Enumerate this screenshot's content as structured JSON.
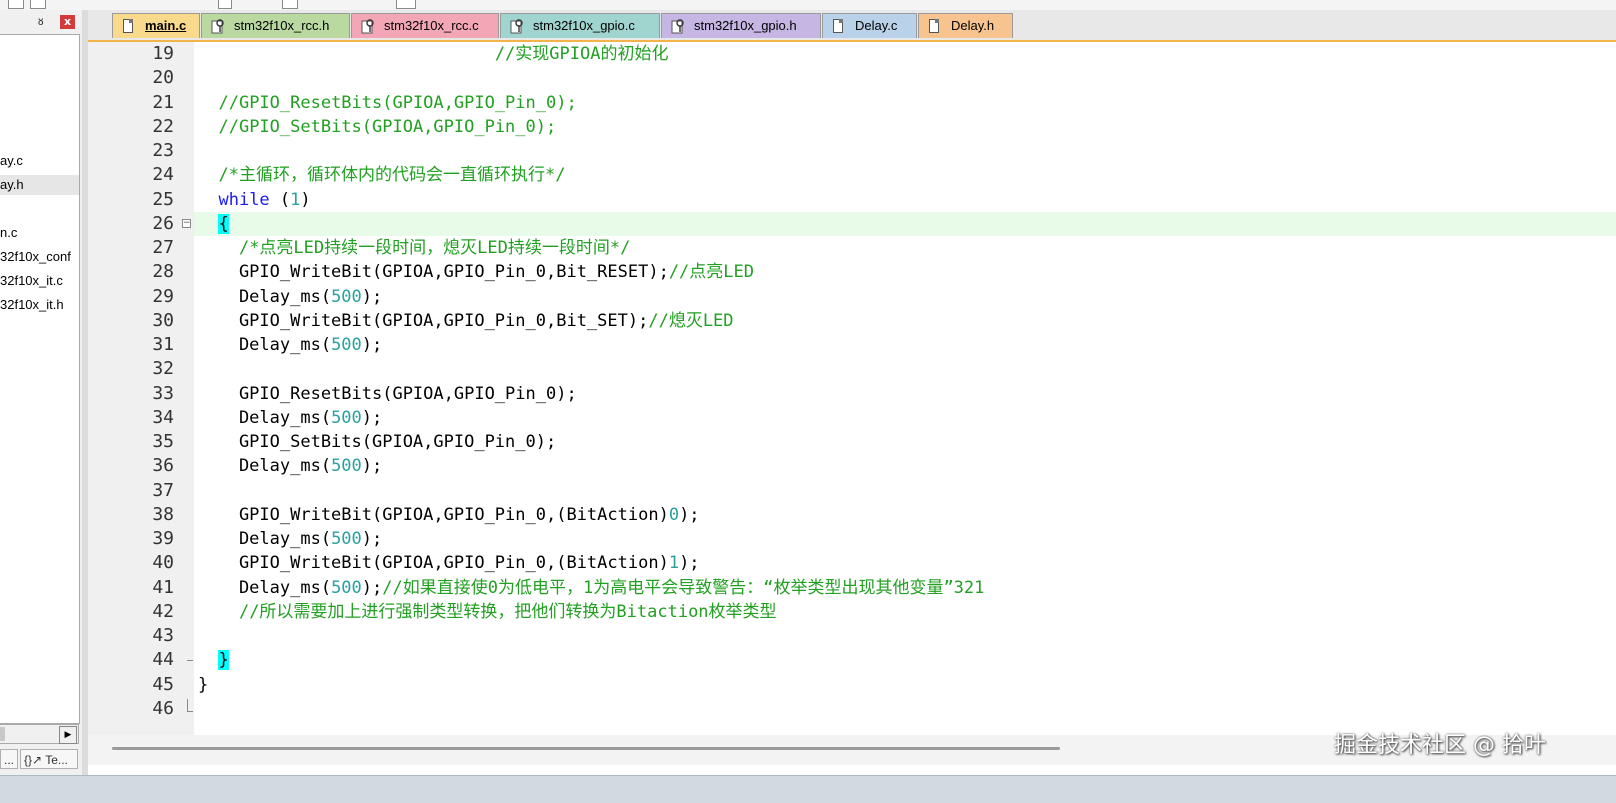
{
  "project_panel": {
    "pin_glyph": "ᵖ",
    "close_glyph": "x",
    "tree_items": [
      {
        "label": "ay.c",
        "selected": false
      },
      {
        "label": "ay.h",
        "selected": true
      },
      {
        "label": "n.c",
        "selected": false
      },
      {
        "label": "32f10x_conf",
        "selected": false
      },
      {
        "label": "32f10x_it.c",
        "selected": false
      },
      {
        "label": "32f10x_it.h",
        "selected": false
      }
    ],
    "bottom_tabs": [
      {
        "label": "..."
      },
      {
        "label": "{}↗ Te..."
      }
    ],
    "scroll_arrow": "▶"
  },
  "tabs": [
    {
      "label": "main.c",
      "active": true,
      "icon": "document-icon",
      "color": "#f9d98b"
    },
    {
      "label": "stm32f10x_rcc.h",
      "active": false,
      "icon": "key-icon",
      "color": "#b9d9a1"
    },
    {
      "label": "stm32f10x_rcc.c",
      "active": false,
      "icon": "key-icon",
      "color": "#f3a7b6"
    },
    {
      "label": "stm32f10x_gpio.c",
      "active": false,
      "icon": "key-icon",
      "color": "#9fd4cf"
    },
    {
      "label": "stm32f10x_gpio.h",
      "active": false,
      "icon": "key-icon",
      "color": "#c6b6e3"
    },
    {
      "label": "Delay.c",
      "active": false,
      "icon": "document-icon",
      "color": "#b9d2ea"
    },
    {
      "label": "Delay.h",
      "active": false,
      "icon": "document-icon",
      "color": "#f7c48f"
    }
  ],
  "code": {
    "current_line": 26,
    "lines": [
      {
        "n": "19",
        "parts": [
          {
            "t": "                             ",
            "c": ""
          },
          {
            "t": "//实现GPIOA的初始化",
            "c": "cm"
          }
        ]
      },
      {
        "n": "20",
        "parts": []
      },
      {
        "n": "21",
        "parts": [
          {
            "t": "  ",
            "c": ""
          },
          {
            "t": "//GPIO_ResetBits(GPIOA,GPIO_Pin_0);",
            "c": "cm"
          }
        ]
      },
      {
        "n": "22",
        "parts": [
          {
            "t": "  ",
            "c": ""
          },
          {
            "t": "//GPIO_SetBits(GPIOA,GPIO_Pin_0);",
            "c": "cm"
          }
        ]
      },
      {
        "n": "23",
        "parts": []
      },
      {
        "n": "24",
        "parts": [
          {
            "t": "  ",
            "c": ""
          },
          {
            "t": "/*主循环，循环体内的代码会一直循环执行*/",
            "c": "cm"
          }
        ]
      },
      {
        "n": "25",
        "parts": [
          {
            "t": "  ",
            "c": ""
          },
          {
            "t": "while",
            "c": "kw"
          },
          {
            "t": " (",
            "c": ""
          },
          {
            "t": "1",
            "c": "num"
          },
          {
            "t": ")",
            "c": ""
          }
        ]
      },
      {
        "n": "26",
        "parts": [
          {
            "t": "  ",
            "c": ""
          },
          {
            "t": "{",
            "c": "br"
          }
        ]
      },
      {
        "n": "27",
        "parts": [
          {
            "t": "    ",
            "c": ""
          },
          {
            "t": "/*点亮LED持续一段时间，熄灭LED持续一段时间*/",
            "c": "cm"
          }
        ]
      },
      {
        "n": "28",
        "parts": [
          {
            "t": "    GPIO_WriteBit(GPIOA,GPIO_Pin_0,Bit_RESET);",
            "c": ""
          },
          {
            "t": "//点亮LED",
            "c": "cm"
          }
        ]
      },
      {
        "n": "29",
        "parts": [
          {
            "t": "    Delay_ms(",
            "c": ""
          },
          {
            "t": "500",
            "c": "num"
          },
          {
            "t": ");",
            "c": ""
          }
        ]
      },
      {
        "n": "30",
        "parts": [
          {
            "t": "    GPIO_WriteBit(GPIOA,GPIO_Pin_0,Bit_SET);",
            "c": ""
          },
          {
            "t": "//熄灭LED",
            "c": "cm"
          }
        ]
      },
      {
        "n": "31",
        "parts": [
          {
            "t": "    Delay_ms(",
            "c": ""
          },
          {
            "t": "500",
            "c": "num"
          },
          {
            "t": ");",
            "c": ""
          }
        ]
      },
      {
        "n": "32",
        "parts": []
      },
      {
        "n": "33",
        "parts": [
          {
            "t": "    GPIO_ResetBits(GPIOA,GPIO_Pin_0);",
            "c": ""
          }
        ]
      },
      {
        "n": "34",
        "parts": [
          {
            "t": "    Delay_ms(",
            "c": ""
          },
          {
            "t": "500",
            "c": "num"
          },
          {
            "t": ");",
            "c": ""
          }
        ]
      },
      {
        "n": "35",
        "parts": [
          {
            "t": "    GPIO_SetBits(GPIOA,GPIO_Pin_0);",
            "c": ""
          }
        ]
      },
      {
        "n": "36",
        "parts": [
          {
            "t": "    Delay_ms(",
            "c": ""
          },
          {
            "t": "500",
            "c": "num"
          },
          {
            "t": ");",
            "c": ""
          }
        ]
      },
      {
        "n": "37",
        "parts": []
      },
      {
        "n": "38",
        "parts": [
          {
            "t": "    GPIO_WriteBit(GPIOA,GPIO_Pin_0,(BitAction)",
            "c": ""
          },
          {
            "t": "0",
            "c": "num"
          },
          {
            "t": ");",
            "c": ""
          }
        ]
      },
      {
        "n": "39",
        "parts": [
          {
            "t": "    Delay_ms(",
            "c": ""
          },
          {
            "t": "500",
            "c": "num"
          },
          {
            "t": ");",
            "c": ""
          }
        ]
      },
      {
        "n": "40",
        "parts": [
          {
            "t": "    GPIO_WriteBit(GPIOA,GPIO_Pin_0,(BitAction)",
            "c": ""
          },
          {
            "t": "1",
            "c": "num"
          },
          {
            "t": ");",
            "c": ""
          }
        ]
      },
      {
        "n": "41",
        "parts": [
          {
            "t": "    Delay_ms(",
            "c": ""
          },
          {
            "t": "500",
            "c": "num"
          },
          {
            "t": ");",
            "c": ""
          },
          {
            "t": "//如果直接使0为低电平，1为高电平会导致警告：“枚举类型出现其他变量”321",
            "c": "cm"
          }
        ]
      },
      {
        "n": "42",
        "parts": [
          {
            "t": "    ",
            "c": ""
          },
          {
            "t": "//所以需要加上进行强制类型转换，把他们转换为Bitaction枚举类型",
            "c": "cm"
          }
        ]
      },
      {
        "n": "43",
        "parts": []
      },
      {
        "n": "44",
        "parts": [
          {
            "t": "  ",
            "c": ""
          },
          {
            "t": "}",
            "c": "br"
          }
        ]
      },
      {
        "n": "45",
        "parts": [
          {
            "t": "}",
            "c": ""
          }
        ]
      },
      {
        "n": "46",
        "parts": []
      }
    ]
  },
  "watermark": "掘金技术社区 @ 拾叶",
  "colors": {
    "comment": "#22a022",
    "keyword": "#1a1aff",
    "number": "#2aa0a0",
    "brace_highlight": "#00ffff",
    "current_line": "#e8fbe8"
  }
}
